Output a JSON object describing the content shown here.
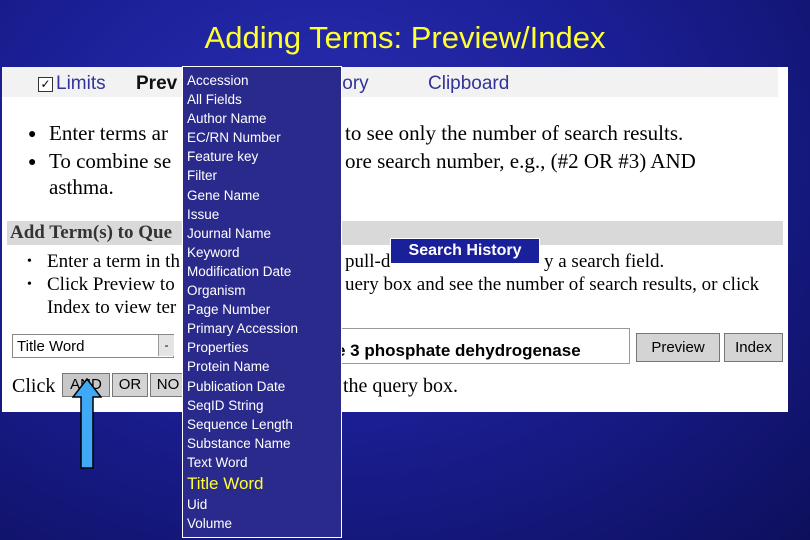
{
  "slide": {
    "title": "Adding Terms: Preview/Index"
  },
  "tabs": {
    "limits": "Limits",
    "preview": "Prev",
    "history": "tory",
    "clipboard": "Clipboard",
    "limits_checked": true
  },
  "bullets": [
    {
      "line1_left": "Enter terms ar",
      "line1_right": "to see only the number of search results."
    },
    {
      "line1_left": "To combine se",
      "line1_right": "ore search number, e.g., (#2 OR #3) AND",
      "line2": "asthma."
    }
  ],
  "section": {
    "title": "Add Term(s) to Que",
    "instructions": [
      {
        "left": "Enter a term in th",
        "right": "pull-d",
        "tail": "y a search field."
      },
      {
        "left": "Click Preview to",
        "right": "uery box and see the number of search results, or click"
      },
      {
        "left": "Index to view ter"
      }
    ]
  },
  "field_select": {
    "value": "Title Word",
    "arrow": "-"
  },
  "query_box": {
    "value": "e 3 phosphate dehydrogenase"
  },
  "buttons": {
    "preview": "Preview",
    "index": "Index",
    "and": "AND",
    "or": "OR",
    "not": "NO"
  },
  "click_line": {
    "click": "Click",
    "suffix": "the query box."
  },
  "badge": {
    "label": "Search History"
  },
  "search_fields": [
    "Accession",
    "All Fields",
    "Author Name",
    "EC/RN Number",
    "Feature key",
    "Filter",
    "Gene Name",
    "Issue",
    "Journal Name",
    "Keyword",
    "Modification Date",
    "Organism",
    "Page Number",
    "Primary Accession",
    "Properties",
    "Protein Name",
    "Publication Date",
    "SeqID String",
    "Sequence Length",
    "Substance Name",
    "Text Word",
    "Title Word",
    "Uid",
    "Volume"
  ],
  "selected_field": "Title Word",
  "colors": {
    "title": "#ffff33",
    "background": "#1b1f96",
    "arrow_fill": "#3fa9f5"
  }
}
